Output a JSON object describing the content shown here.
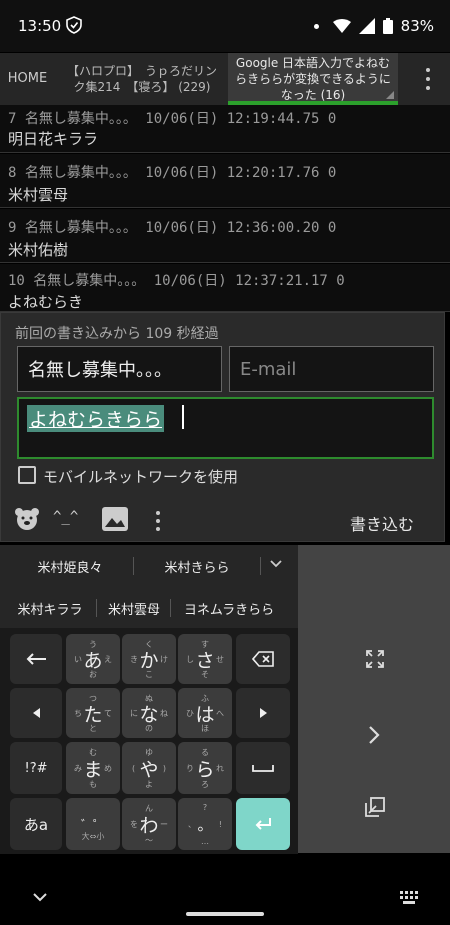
{
  "status": {
    "time": "13:50",
    "battery": "83%"
  },
  "tabs": {
    "home": "HOME",
    "tab1": "【ハロプロ】　うｐろだリン\nク集214　【寝ろ】 (229)",
    "tab2": "Google 日本語入力でよねむ\nらきららが変換できるように\nなった (16)"
  },
  "posts": [
    {
      "header": "7  名無し募集中。。。  10/06(日) 12:19:44.75 0",
      "body": "明日花キララ"
    },
    {
      "header": "8  名無し募集中。。。  10/06(日) 12:20:17.76 0",
      "body": "米村雲母"
    },
    {
      "header": "9  名無し募集中。。。  10/06(日) 12:36:00.20 0",
      "body": "米村佑樹"
    },
    {
      "header": "10  名無し募集中。。。  10/06(日) 12:37:21.17 0",
      "body": "よねむらき"
    }
  ],
  "composer": {
    "elapsed": "前回の書き込みから 109 秒経過",
    "name": "名無し募集中。。。",
    "email_placeholder": "E-mail",
    "message": "よねむらきらら",
    "mobile_label": "モバイルネットワークを使用",
    "kaomoji": "^_^",
    "post_label": "書き込む"
  },
  "suggestions": {
    "row1": [
      "米村姫良々",
      "米村きらら"
    ],
    "row2": [
      "米村キララ",
      "米村雲母",
      "ヨネムラきらら"
    ]
  },
  "keyboard": {
    "keys": {
      "a": "あ",
      "ka": "か",
      "sa": "さ",
      "ta": "た",
      "na": "な",
      "ha": "は",
      "ma": "ま",
      "ya": "や",
      "ra": "ら",
      "wa": "わ",
      "sym": "!?#",
      "kana": "あa"
    }
  }
}
